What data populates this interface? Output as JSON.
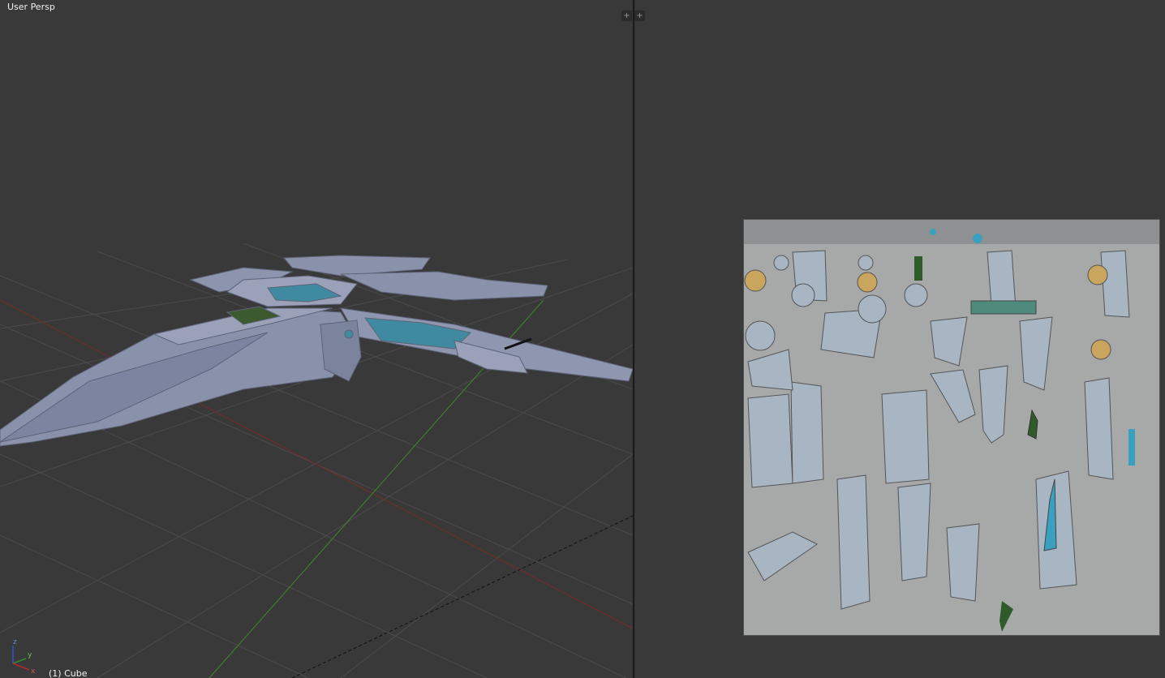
{
  "viewport": {
    "view_label": "User Persp",
    "object_label": "(1) Cube",
    "axes": {
      "x": "x",
      "y": "y",
      "z": "z"
    }
  },
  "split_widgets": {
    "left": "+",
    "right": "+"
  },
  "colors": {
    "background": "#393939",
    "grid": "#4a4a4a",
    "x_axis": "#8a2a2a",
    "y_axis": "#3b8a2b",
    "mesh": "#8b93b0",
    "uv_bg": "#a7a8a8"
  }
}
